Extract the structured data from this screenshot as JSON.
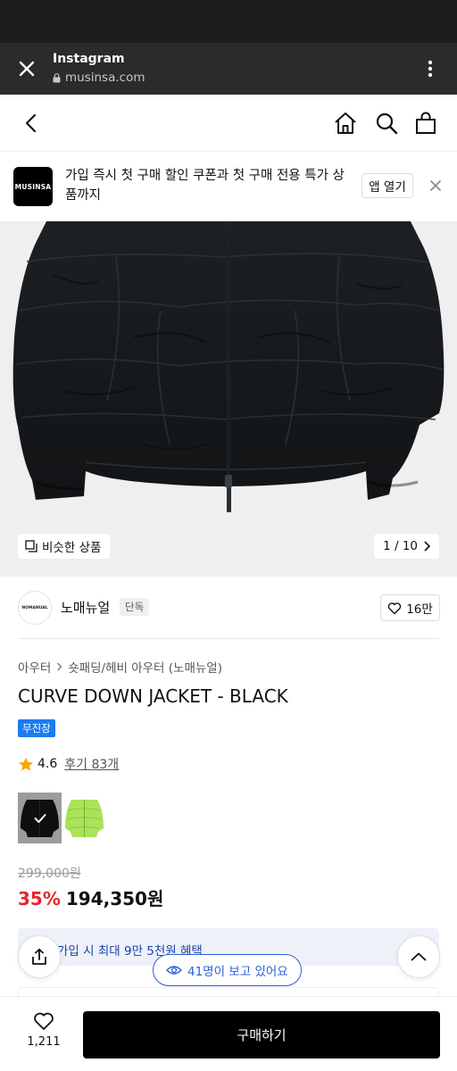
{
  "browser": {
    "title": "Instagram",
    "url": "musinsa.com",
    "close_icon": "close-icon",
    "more_icon": "more-vertical-icon"
  },
  "nav": {
    "icons": [
      "back-icon",
      "home-icon",
      "search-icon",
      "shopping-bag-icon"
    ]
  },
  "promo": {
    "logo_text": "MUSINSA",
    "text": "가입 즉시 첫 구매 할인 쿠폰과 첫 구매 전용 특가 상품까지",
    "open_label": "앱 열기"
  },
  "gallery": {
    "similar_label": "비슷한 상품",
    "pager_text": "1 / 10"
  },
  "brand": {
    "logo_text": "NOMANUAL",
    "name": "노매뉴얼",
    "badge": "단독",
    "likes": "16만"
  },
  "product": {
    "breadcrumb": [
      "아우터",
      "숏패딩/헤비 아우터 (노매뉴얼)"
    ],
    "title": "CURVE DOWN JACKET - BLACK",
    "shipping_badge": "무진장",
    "rating": "4.6",
    "review_link": "후기 83개",
    "colors": [
      "black",
      "lime"
    ],
    "original_price": "299,000원",
    "discount": "35%",
    "sale_price": "194,350원"
  },
  "benefit": {
    "text": "가입 시 최대 9만 5천원 혜택"
  },
  "viewers": {
    "text": "41명이 보고 있어요"
  },
  "bottom": {
    "like_count": "1,211",
    "buy_label": "구매하기"
  },
  "colors": {
    "accent_blue": "#1c7cf1",
    "discount_red": "#e2282e",
    "viewer_blue": "#2d5fd8",
    "star": "#f7a600"
  }
}
